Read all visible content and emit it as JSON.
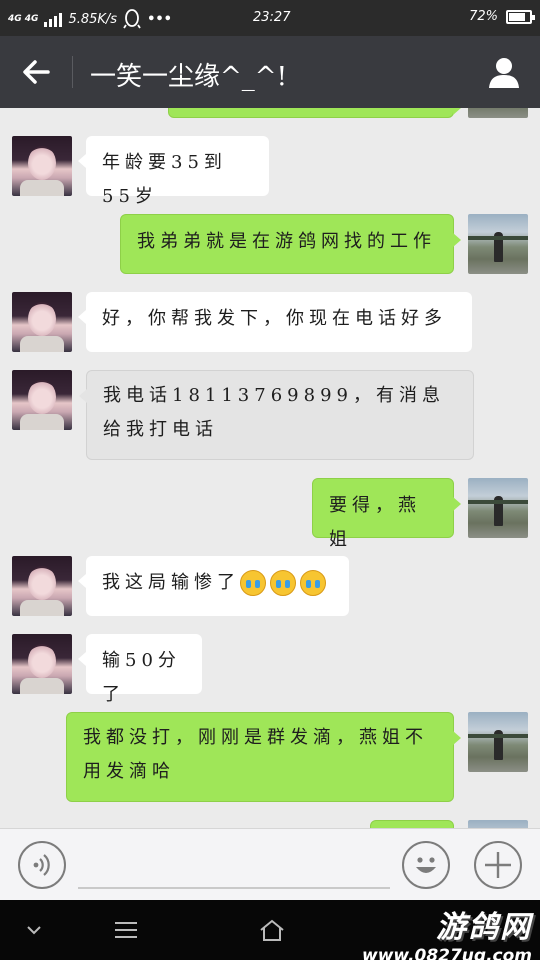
{
  "status_bar": {
    "network": "4G 4G",
    "speed": "5.85K/s",
    "more": "•••",
    "time": "23:27",
    "battery": "72%",
    "battery_level": 0.72
  },
  "header": {
    "title": "一笑一尘缘^_^!"
  },
  "messages": [
    {
      "side": "in",
      "text": "年龄要35到55岁"
    },
    {
      "side": "out",
      "text": "我弟弟就是在游鸽网找的工作"
    },
    {
      "side": "in",
      "text": "好，你帮我发下，你现在电话好多"
    },
    {
      "side": "in",
      "text": "我电话18113769899，有消息给我打电话"
    },
    {
      "side": "out",
      "text": "要得，燕姐"
    },
    {
      "side": "in",
      "text": "我这局输惨了",
      "emojis": [
        "crying-face",
        "crying-face",
        "crying-face"
      ]
    },
    {
      "side": "in",
      "text": "输50分了"
    },
    {
      "side": "out",
      "text": "我都没打，刚刚是群发滴，燕姐不用发滴哈"
    }
  ],
  "watermark": {
    "name": "游鸽网",
    "url": "www.0827ug.com"
  },
  "colors": {
    "header": "#393a3f",
    "outgoing_bubble": "#9fe658",
    "incoming_bubble": "#ffffff",
    "background": "#ebebeb"
  }
}
